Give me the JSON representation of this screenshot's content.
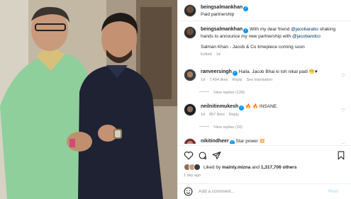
{
  "header": {
    "username": "beingsalmankhan",
    "subtitle": "Paid partnership",
    "avatar_icon": "profile-avatar"
  },
  "caption": {
    "username": "beingsalmankhan",
    "text_1": "With my dear friend",
    "mention_1": "@jacobarabo",
    "text_2": "shaking hands to announce my new partnership with",
    "mention_2": "@jacobandco",
    "text_3": "Salman Khan - Jacob & Co timepiece coming soon",
    "edited": "Edited",
    "time": "1d"
  },
  "comments": [
    {
      "username": "ranveersingh",
      "text": "Haila. Jacob Bhai ki toh nikal padi 😬♥",
      "time": "1d",
      "likes": "7,494 likes",
      "reply": "Reply",
      "translation": "See translation",
      "view_replies": "View replies (129)"
    },
    {
      "username": "neilnitinmukesh",
      "text": "🔥 🔥 INSANE.",
      "time": "1d",
      "likes": "857 likes",
      "reply": "Reply",
      "view_replies": "View replies (20)"
    },
    {
      "username": "nikitindheer",
      "text": "Star power 💥"
    }
  ],
  "likes": {
    "prefix": "Liked by",
    "user": "mainly.mizna",
    "middle": "and",
    "count": "1,317,706 others"
  },
  "time_ago": "1 day ago",
  "add_comment": {
    "placeholder": "Add a comment...",
    "post_label": "Post"
  },
  "colors": {
    "link": "#00376b",
    "verified": "#0095f6",
    "muted": "#8e8e8e",
    "post_disabled": "#b2dffc"
  }
}
